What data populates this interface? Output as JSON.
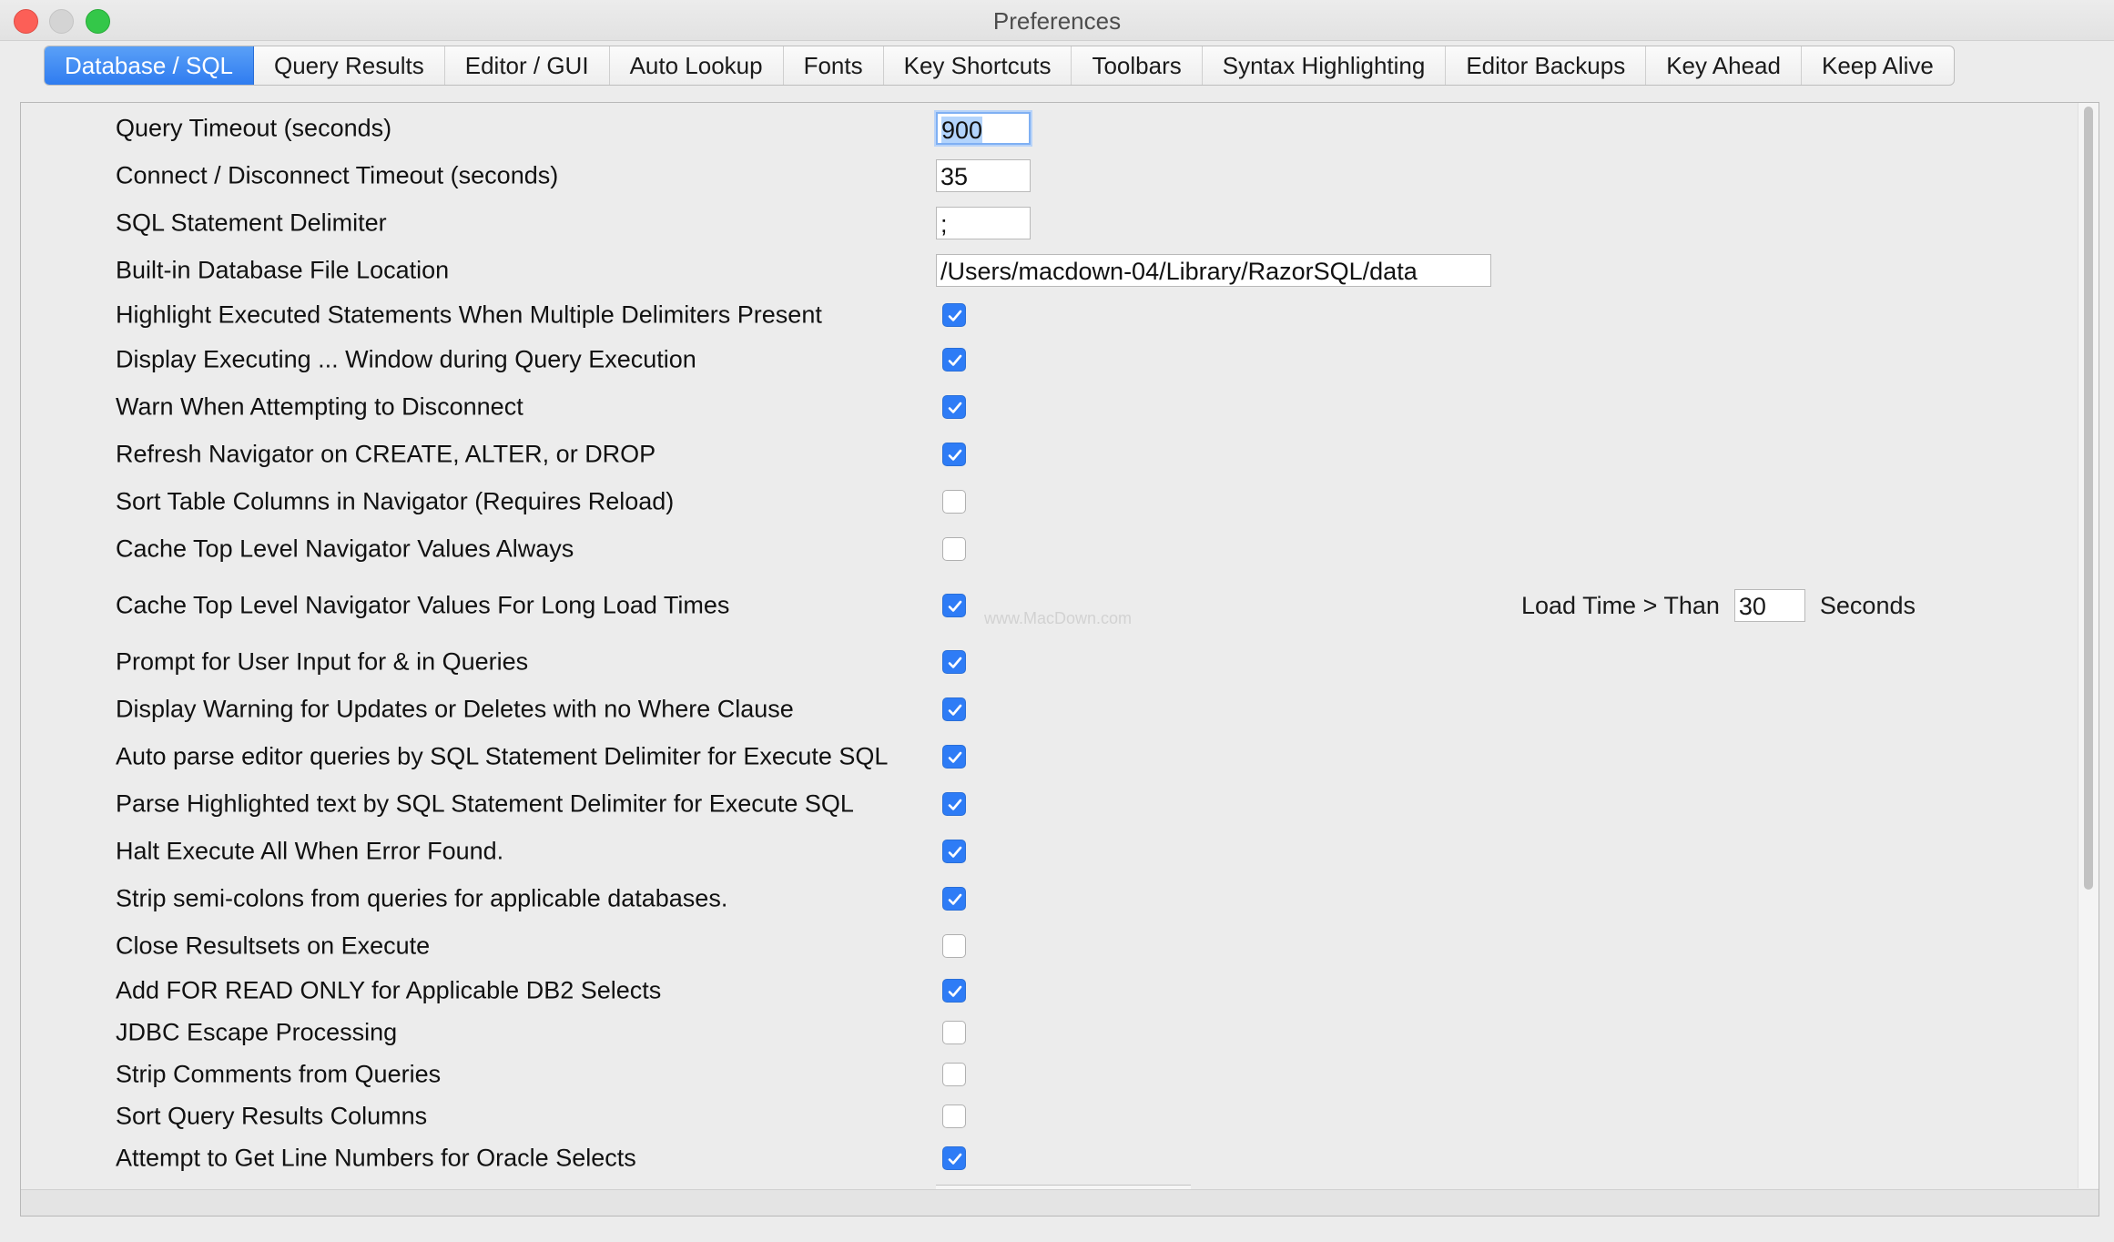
{
  "window": {
    "title": "Preferences"
  },
  "tabs": [
    {
      "label": "Database / SQL",
      "active": true
    },
    {
      "label": "Query Results"
    },
    {
      "label": "Editor / GUI"
    },
    {
      "label": "Auto Lookup"
    },
    {
      "label": "Fonts"
    },
    {
      "label": "Key Shortcuts"
    },
    {
      "label": "Toolbars"
    },
    {
      "label": "Syntax Highlighting"
    },
    {
      "label": "Editor Backups"
    },
    {
      "label": "Key Ahead"
    },
    {
      "label": "Keep Alive"
    }
  ],
  "fields": {
    "query_timeout": {
      "label": "Query Timeout (seconds)",
      "value": "900"
    },
    "connect_timeout": {
      "label": "Connect / Disconnect Timeout (seconds)",
      "value": "35"
    },
    "delimiter": {
      "label": "SQL Statement Delimiter",
      "value": ";"
    },
    "db_file_location": {
      "label": "Built-in Database File Location",
      "value": "/Users/macdown-04/Library/RazorSQL/data"
    }
  },
  "options": [
    {
      "label": "Highlight Executed Statements When Multiple Delimiters Present",
      "checked": true
    },
    {
      "label": "Display Executing ... Window during Query Execution",
      "checked": true
    },
    {
      "label": "Warn When Attempting to Disconnect",
      "checked": true
    },
    {
      "label": "Refresh Navigator on CREATE, ALTER, or DROP",
      "checked": true
    },
    {
      "label": "Sort Table Columns in Navigator (Requires Reload)",
      "checked": false
    },
    {
      "label": "Cache Top Level Navigator Values Always",
      "checked": false
    },
    {
      "label": "Cache Top Level Navigator Values For Long Load Times",
      "checked": true
    },
    {
      "label": "Prompt for User Input for & in Queries",
      "checked": true
    },
    {
      "label": "Display Warning for Updates or Deletes with no Where Clause",
      "checked": true
    },
    {
      "label": "Auto parse editor queries by SQL Statement Delimiter for Execute SQL",
      "checked": true
    },
    {
      "label": "Parse Highlighted text by SQL Statement Delimiter for Execute SQL",
      "checked": true
    },
    {
      "label": "Halt Execute All When Error Found.",
      "checked": true
    },
    {
      "label": "Strip semi-colons from queries for applicable databases.",
      "checked": true
    },
    {
      "label": "Close Resultsets on Execute",
      "checked": false
    },
    {
      "label": "Add FOR READ ONLY for Applicable DB2 Selects",
      "checked": true
    },
    {
      "label": "JDBC Escape Processing",
      "checked": false
    },
    {
      "label": "Strip Comments from Queries",
      "checked": false
    },
    {
      "label": "Sort Query Results Columns",
      "checked": false
    },
    {
      "label": "Attempt to Get Line Numbers for Oracle Selects",
      "checked": true
    }
  ],
  "load_time": {
    "prefix": "Load Time > Than",
    "value": "30",
    "suffix": "Seconds"
  },
  "watermark": "www.MacDown.com"
}
